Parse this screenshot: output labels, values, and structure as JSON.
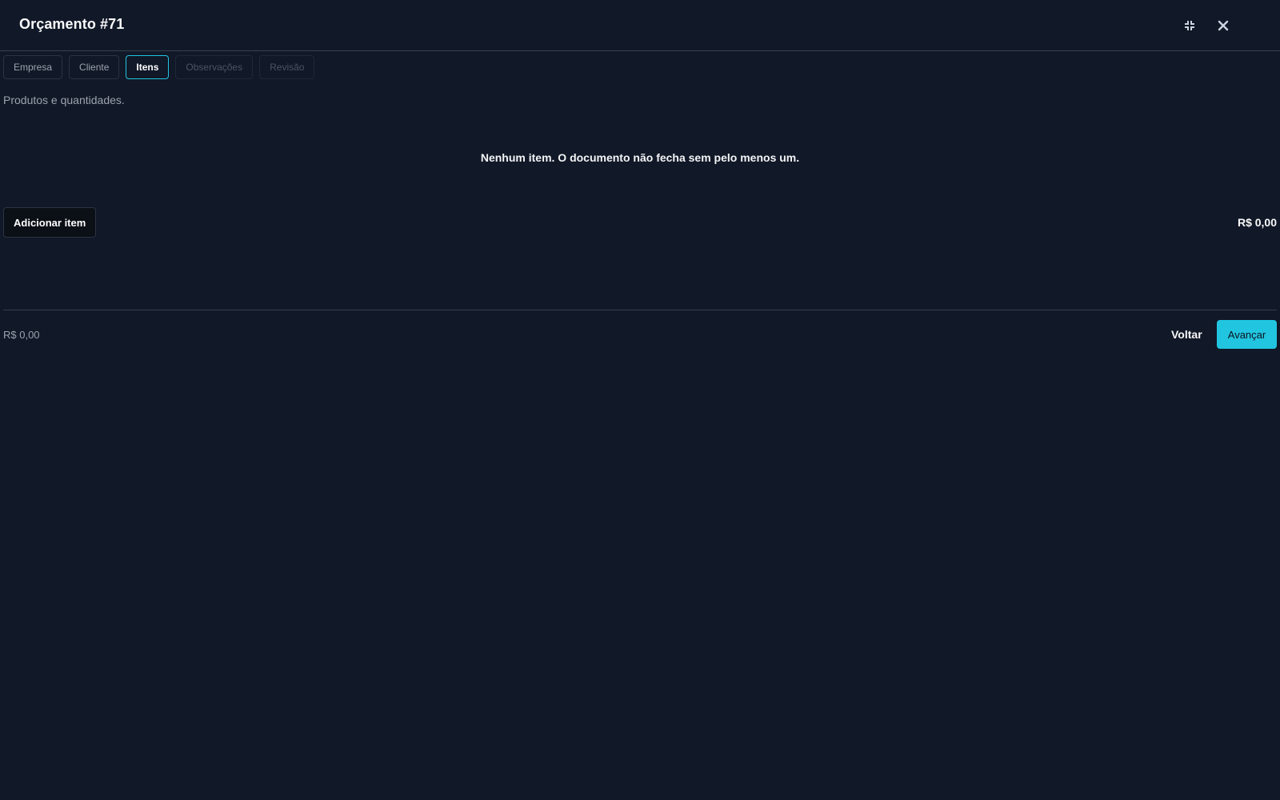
{
  "header": {
    "title": "Orçamento #71",
    "minimize_icon": "collapse-icon",
    "close_icon": "close-icon"
  },
  "tabs": [
    {
      "label": "Empresa",
      "state": "normal"
    },
    {
      "label": "Cliente",
      "state": "normal"
    },
    {
      "label": "Itens",
      "state": "active"
    },
    {
      "label": "Observações",
      "state": "disabled"
    },
    {
      "label": "Revisão",
      "state": "disabled"
    }
  ],
  "main": {
    "subtitle": "Produtos e quantidades.",
    "empty_message": "Nenhum item. O documento não fecha sem pelo menos um.",
    "add_button_label": "Adicionar item",
    "items_total": "R$ 0,00"
  },
  "footer": {
    "total": "R$ 0,00",
    "back_label": "Voltar",
    "next_label": "Avançar"
  },
  "colors": {
    "background": "#111827",
    "accent": "#22c5e0"
  }
}
